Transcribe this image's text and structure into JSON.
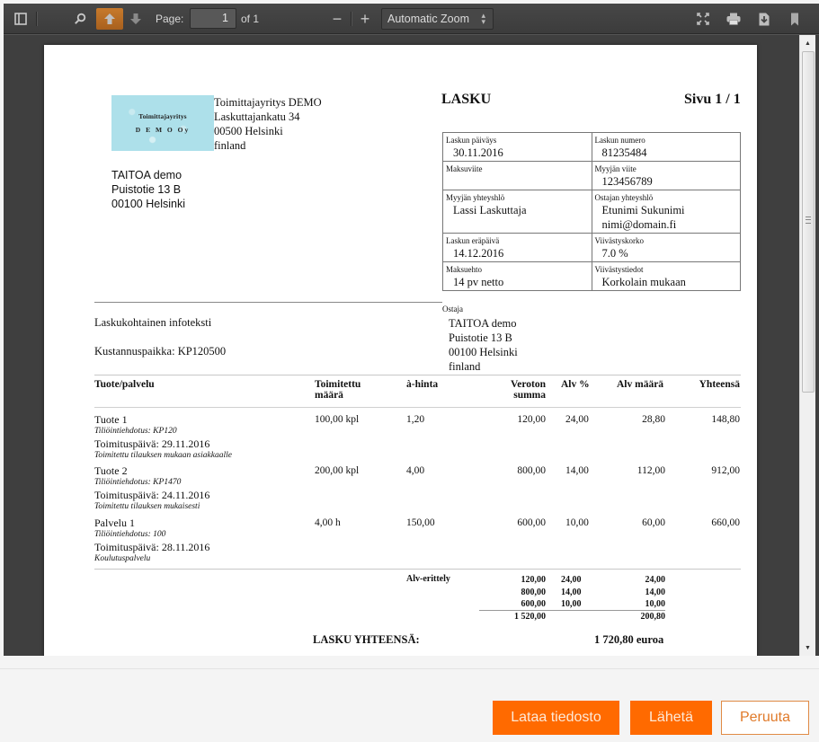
{
  "toolbar": {
    "sidebar_toggle_icon": "sidebar-toggle-icon",
    "find_icon": "search-icon",
    "prev_icon": "arrow-up-icon",
    "next_icon": "arrow-down-icon",
    "page_label": "Page:",
    "page_value": "1",
    "page_of": "of 1",
    "zoom_out": "−",
    "zoom_in": "+",
    "zoom_select": "Automatic Zoom",
    "presentation_icon": "fullscreen-icon",
    "print_icon": "printer-icon",
    "download_icon": "download-icon",
    "bookmark_icon": "bookmark-icon"
  },
  "invoice": {
    "logo": {
      "line1": "Toimittajayritys",
      "line2": "D E M O Oy"
    },
    "supplier": [
      "Toimittajayritys DEMO",
      "Laskuttajankatu 34",
      "00500 Helsinki",
      "finland"
    ],
    "recipient": [
      "TAITOA demo",
      "Puistotie 13 B",
      "00100 Helsinki"
    ],
    "title": "LASKU",
    "page": "Sivu 1 / 1",
    "info": [
      [
        {
          "label": "Laskun päiväys",
          "value": [
            "30.11.2016"
          ]
        },
        {
          "label": "Laskun numero",
          "value": [
            "81235484"
          ]
        }
      ],
      [
        {
          "label": "Maksuviite",
          "value": [
            ""
          ]
        },
        {
          "label": "Myyjän viite",
          "value": [
            "123456789"
          ]
        }
      ],
      [
        {
          "label": "Myyjän yhteyshlö",
          "value": [
            "Lassi Laskuttaja"
          ]
        },
        {
          "label": "Ostajan yhteyshlö",
          "value": [
            "Etunimi Sukunimi",
            "nimi@domain.fi"
          ]
        }
      ],
      [
        {
          "label": "Laskun eräpäivä",
          "value": [
            "14.12.2016"
          ]
        },
        {
          "label": "Viivästyskorko",
          "value": [
            "7.0 %"
          ]
        }
      ],
      [
        {
          "label": "Maksuehto",
          "value": [
            "14 pv netto"
          ]
        },
        {
          "label": "Viivästystiedot",
          "value": [
            "Korkolain mukaan"
          ]
        }
      ]
    ],
    "infotext": "Laskukohtainen infoteksti",
    "cost_center": "Kustannuspaikka: KP120500",
    "buyer_label": "Ostaja",
    "buyer": [
      "TAITOA demo",
      "Puistotie 13 B",
      "00100 Helsinki",
      "finland"
    ],
    "columns": {
      "product": "Tuote/palvelu",
      "qty": [
        "Toimitettu",
        "määrä"
      ],
      "unit_price": "à-hinta",
      "net": [
        "Veroton",
        "summa"
      ],
      "vat_pct": "Alv %",
      "vat_amount": "Alv määrä",
      "total": "Yhteensä"
    },
    "rows": [
      {
        "name": "Tuote 1",
        "account": "Tiliöintiehdotus: KP120",
        "delivery": "Toimituspäivä: 29.11.2016",
        "note": "Toimitettu tilauksen mukaan asiakkaalle",
        "qty": "100,00 kpl",
        "unit_price": "1,20",
        "net": "120,00",
        "vat_pct": "24,00",
        "vat_amount": "28,80",
        "total": "148,80"
      },
      {
        "name": "Tuote 2",
        "account": "Tiliöintiehdotus: KP1470",
        "delivery": "Toimituspäivä: 24.11.2016",
        "note": "Toimitettu tilauksen mukaisesti",
        "qty": "200,00 kpl",
        "unit_price": "4,00",
        "net": "800,00",
        "vat_pct": "14,00",
        "vat_amount": "112,00",
        "total": "912,00"
      },
      {
        "name": "Palvelu 1",
        "account": "Tiliöintiehdotus: 100",
        "delivery": "Toimituspäivä: 28.11.2016",
        "note": "Koulutuspalvelu",
        "qty": "4,00 h",
        "unit_price": "150,00",
        "net": "600,00",
        "vat_pct": "10,00",
        "vat_amount": "60,00",
        "total": "660,00"
      }
    ],
    "vat_breakdown": {
      "label": "Alv-erittely",
      "rows": [
        {
          "net": "120,00",
          "pct": "24,00",
          "vat": "24,00"
        },
        {
          "net": "800,00",
          "pct": "14,00",
          "vat": "14,00"
        },
        {
          "net": "600,00",
          "pct": "10,00",
          "vat": "10,00"
        }
      ],
      "total_net": "1 520,00",
      "total_vat": "200,80"
    },
    "total_label": "LASKU YHTEENSÄ:",
    "total_value": "1 720,80 euroa"
  },
  "footer": {
    "download_label": "Lataa tiedosto",
    "send_label": "Lähetä",
    "cancel_label": "Peruuta"
  },
  "colors": {
    "accent": "#ff6a00",
    "toolbar": "#404040"
  }
}
